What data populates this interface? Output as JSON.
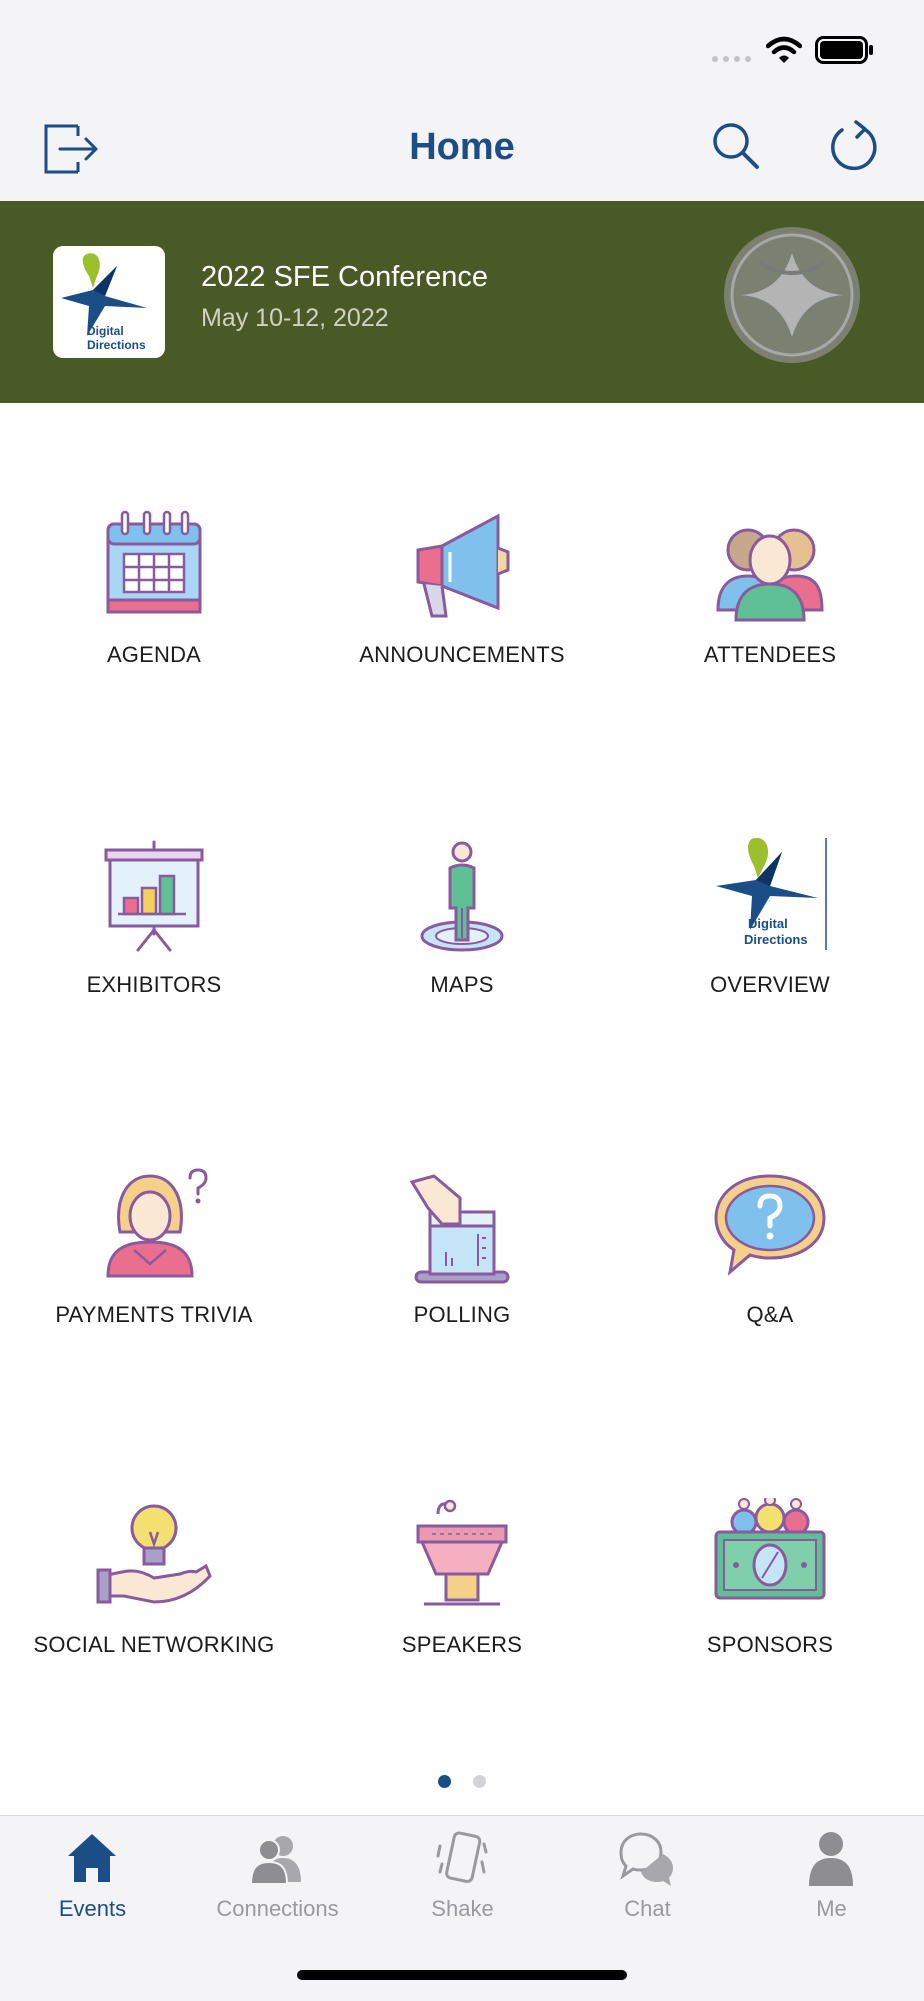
{
  "header": {
    "title": "Home",
    "exit_icon": "exit-icon",
    "search_icon": "search-icon",
    "refresh_icon": "refresh-icon"
  },
  "banner": {
    "title": "2022 SFE Conference",
    "date": "May 10-12, 2022",
    "logo_text_line1": "Digital",
    "logo_text_line2": "Directions",
    "background": "#4a5a26"
  },
  "grid": {
    "items": [
      {
        "label": "AGENDA",
        "icon": "calendar-icon"
      },
      {
        "label": "ANNOUNCEMENTS",
        "icon": "megaphone-icon"
      },
      {
        "label": "ATTENDEES",
        "icon": "people-icon"
      },
      {
        "label": "EXHIBITORS",
        "icon": "presentation-board-icon"
      },
      {
        "label": "MAPS",
        "icon": "map-pin-person-icon"
      },
      {
        "label": "OVERVIEW",
        "icon": "digital-directions-logo-icon"
      },
      {
        "label": "PAYMENTS TRIVIA",
        "icon": "woman-question-icon"
      },
      {
        "label": "POLLING",
        "icon": "ballot-box-icon"
      },
      {
        "label": "Q&A",
        "icon": "question-bubble-icon"
      },
      {
        "label": "SOCIAL NETWORKING",
        "icon": "idea-hand-icon"
      },
      {
        "label": "SPEAKERS",
        "icon": "podium-icon"
      },
      {
        "label": "SPONSORS",
        "icon": "money-people-icon"
      }
    ]
  },
  "pager": {
    "current_page": 1,
    "total_pages": 2
  },
  "tabbar": {
    "active": "Events",
    "items": [
      {
        "label": "Events",
        "icon": "home-icon"
      },
      {
        "label": "Connections",
        "icon": "connections-icon"
      },
      {
        "label": "Shake",
        "icon": "shake-phone-icon"
      },
      {
        "label": "Chat",
        "icon": "chat-bubbles-icon"
      },
      {
        "label": "Me",
        "icon": "person-icon"
      }
    ]
  },
  "colors": {
    "accent": "#1b4e86",
    "banner": "#4a5a26",
    "tab_inactive": "#9a9a9e",
    "bar_background": "#f4f3f6"
  }
}
